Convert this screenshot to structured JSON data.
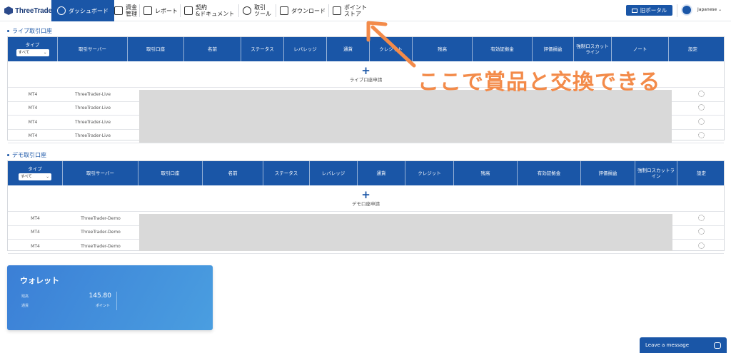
{
  "nav": {
    "logo": "ThreeTrader",
    "items": [
      {
        "label": "ダッシュボード",
        "icon": "dashboard-icon",
        "active": true
      },
      {
        "label_1": "資金",
        "label_2": "管理",
        "icon": "wallet-icon"
      },
      {
        "label": "レポート",
        "icon": "report-icon"
      },
      {
        "label_1": "契約",
        "label_2": "&ドキュメント",
        "icon": "document-icon"
      },
      {
        "label_1": "取引",
        "label_2": "ツール",
        "icon": "tools-icon"
      },
      {
        "label": "ダウンロード",
        "icon": "download-icon"
      },
      {
        "label_1": "ポイント",
        "label_2": "ストア",
        "icon": "cart-icon"
      }
    ],
    "old_portal": "旧ポータル",
    "language": "Japanese"
  },
  "live": {
    "title": "ライブ取引口座",
    "headers": [
      "タイプ",
      "取引サーバー",
      "取引口座",
      "名前",
      "ステータス",
      "レバレッジ",
      "通貨",
      "クレジット",
      "残高",
      "有効証拠金",
      "評価損益",
      "強制ロスカットライン",
      "ノート",
      "設定"
    ],
    "type_select": "すべて",
    "apply_label": "ライブ口座申請",
    "rows": [
      {
        "platform": "MT4",
        "server": "ThreeTrader-Live"
      },
      {
        "platform": "MT4",
        "server": "ThreeTrader-Live"
      },
      {
        "platform": "MT4",
        "server": "ThreeTrader-Live"
      },
      {
        "platform": "MT4",
        "server": "ThreeTrader-Live"
      }
    ]
  },
  "demo": {
    "title": "デモ取引口座",
    "headers": [
      "タイプ",
      "取引サーバー",
      "取引口座",
      "名前",
      "ステータス",
      "レバレッジ",
      "通貨",
      "クレジット",
      "残高",
      "有効証拠金",
      "評価損益",
      "強制ロスカットライン",
      "設定"
    ],
    "type_select": "すべて",
    "apply_label": "デモ口座申請",
    "rows": [
      {
        "platform": "MT4",
        "server": "ThreeTrader-Demo"
      },
      {
        "platform": "MT4",
        "server": "ThreeTrader-Demo"
      },
      {
        "platform": "MT4",
        "server": "ThreeTrader-Demo"
      }
    ]
  },
  "wallet": {
    "title": "ウォレット",
    "label_1": "残高",
    "label_2": "通貨",
    "value": "145.80",
    "unit": "ポイント"
  },
  "chat": {
    "label": "Leave a message"
  },
  "annotation": {
    "text": "ここで賞品と交換できる",
    "color": "#f38b4a"
  },
  "colors": {
    "primary": "#1a56a7",
    "mask": "#d9d9d9"
  }
}
